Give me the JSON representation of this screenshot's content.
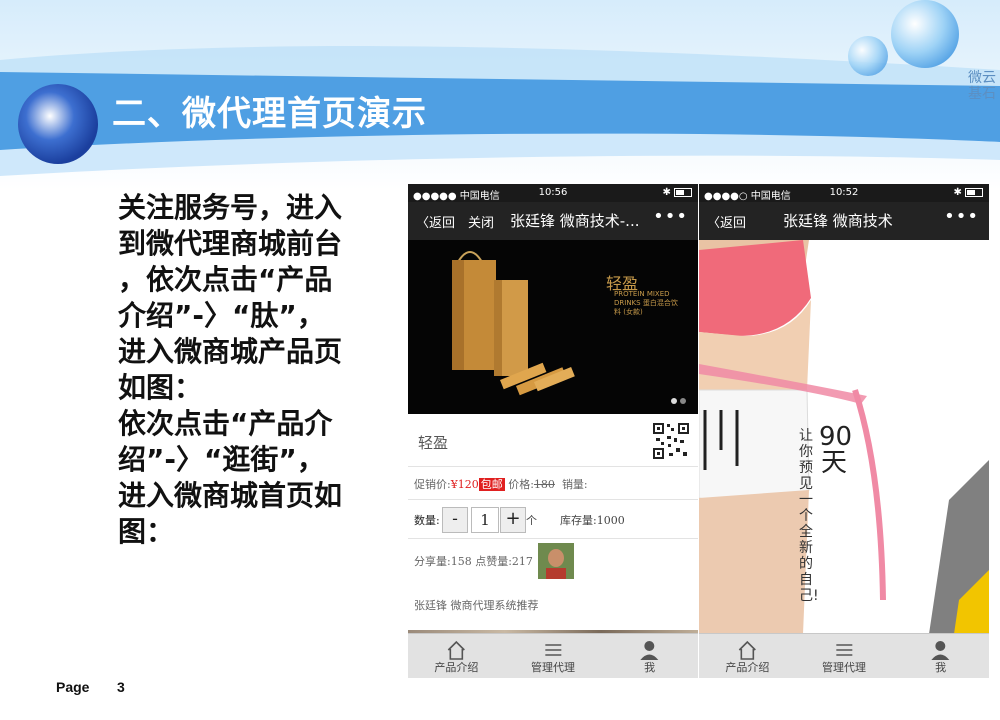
{
  "slide": {
    "title": "二、微代理首页演示",
    "brand_line1": "微云",
    "brand_line2": "基石",
    "description": [
      "关注服务号，进入",
      "到微代理商城前台",
      "，依次点击“产品",
      "介绍”-〉“肽”，",
      "进入微商城产品页",
      "如图：",
      "依次点击“产品介",
      "绍”-〉“逛街”，",
      "进入微商城首页如",
      "图："
    ],
    "page_label": "Page",
    "page_number": "3"
  },
  "phone1": {
    "status": {
      "carrier": "●●●●● 中国电信",
      "time": "10:56"
    },
    "nav": {
      "back_label": "返回",
      "close_label": "关闭",
      "title": "张廷锋 微商技术-...",
      "more": "•••"
    },
    "hero": {
      "brand_text": "轻盈",
      "brand_sub": "PROTEIN MIXED DRINKS 蛋白混合饮料 (女款)"
    },
    "product_name": "轻盈",
    "price": {
      "label": "促销价:",
      "value": "¥120",
      "tag": "包邮",
      "orig_label": "价格:",
      "orig_value": "180",
      "sales_label": "销量:"
    },
    "quantity": {
      "label": "数量:",
      "minus": "-",
      "value": "1",
      "plus": "+",
      "unit": "个",
      "stock": "库存量:1000"
    },
    "share": {
      "text": "分享量:158 点赞量:217",
      "recommend": "张廷锋 微商代理系统推荐"
    },
    "tabs": [
      {
        "label": "产品介绍",
        "icon": "home-icon"
      },
      {
        "label": "管理代理",
        "icon": "list-icon"
      },
      {
        "label": "我",
        "icon": "user-icon"
      }
    ]
  },
  "phone2": {
    "status": {
      "carrier": "●●●●○ 中国电信",
      "time": "10:52"
    },
    "nav": {
      "back_label": "返回",
      "title": "张廷锋 微商技术",
      "more": "•••"
    },
    "hero": {
      "big": "90天",
      "slogan": "让你预见一个全新的自己!"
    },
    "tabs": [
      {
        "label": "产品介绍",
        "icon": "home-icon"
      },
      {
        "label": "管理代理",
        "icon": "list-icon"
      },
      {
        "label": "我",
        "icon": "user-icon"
      }
    ]
  },
  "colors": {
    "banner_blue": "#5aa6e6",
    "price_red": "#e02020",
    "nav_dark": "#232323"
  }
}
